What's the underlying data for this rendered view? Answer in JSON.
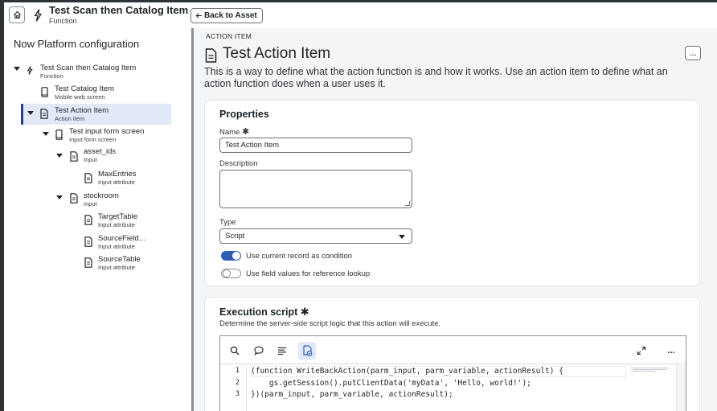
{
  "header": {
    "title": "Test Scan then Catalog Item",
    "subtitle": "Function",
    "back_label": "Back to Asset"
  },
  "sidebar": {
    "title": "Now Platform configuration",
    "nodes": [
      {
        "label": "Test Scan then Catalog Item",
        "sub": "Function"
      },
      {
        "label": "Test Catalog Item",
        "sub": "Mobile web screen"
      },
      {
        "label": "Test Action Item",
        "sub": "Action item"
      },
      {
        "label": "Test input form screen",
        "sub": "Input form screen"
      },
      {
        "label": "asset_ids",
        "sub": "Input"
      },
      {
        "label": "MaxEntries",
        "sub": "Input attribute"
      },
      {
        "label": "stockroom",
        "sub": "Input"
      },
      {
        "label": "TargetTable",
        "sub": "Input attribute"
      },
      {
        "label": "SourceField...",
        "sub": "Input attribute"
      },
      {
        "label": "SourceTable",
        "sub": "Input attribute"
      }
    ]
  },
  "main": {
    "eyebrow": "ACTION ITEM",
    "title": "Test Action Item",
    "description": "This is a way to define what the action function is and how it works. Use an action item to define what an action function does when a user uses it.",
    "more_label": "...",
    "properties": {
      "heading": "Properties",
      "name_label": "Name",
      "name_value": "Test Action Item",
      "description_label": "Description",
      "description_value": "",
      "type_label": "Type",
      "type_value": "Script",
      "toggle1_label": "Use current record as condition",
      "toggle1_on": true,
      "toggle2_label": "Use field values for reference lookup",
      "toggle2_on": false
    },
    "execution": {
      "heading": "Execution script",
      "subtitle": "Determine the server-side script logic that this action will execute.",
      "more_label": "...",
      "code_lines": [
        {
          "num": "1",
          "text": "(function WriteBackAction(parm_input, parm_variable, actionResult) {"
        },
        {
          "num": "2",
          "text": "    gs.getSession().putClientData('myData', 'Hello, world!');"
        },
        {
          "num": "3",
          "text": "})(parm_input, parm_variable, actionResult);"
        }
      ]
    }
  },
  "colors": {
    "accent": "#2f5db5",
    "selected_bg": "#e1e9f7",
    "selected_bar": "#293e8a",
    "frame_dark": "#2e3338",
    "panel_bg": "#f4f5f7"
  },
  "icons": [
    "home-icon",
    "function-icon",
    "arrow-left-icon",
    "mobile-screen-icon",
    "document-icon",
    "search-icon",
    "comment-icon",
    "format-icon",
    "script-check-icon",
    "expand-icon",
    "more-icon",
    "required-star-icon",
    "chevron-down-icon"
  ]
}
